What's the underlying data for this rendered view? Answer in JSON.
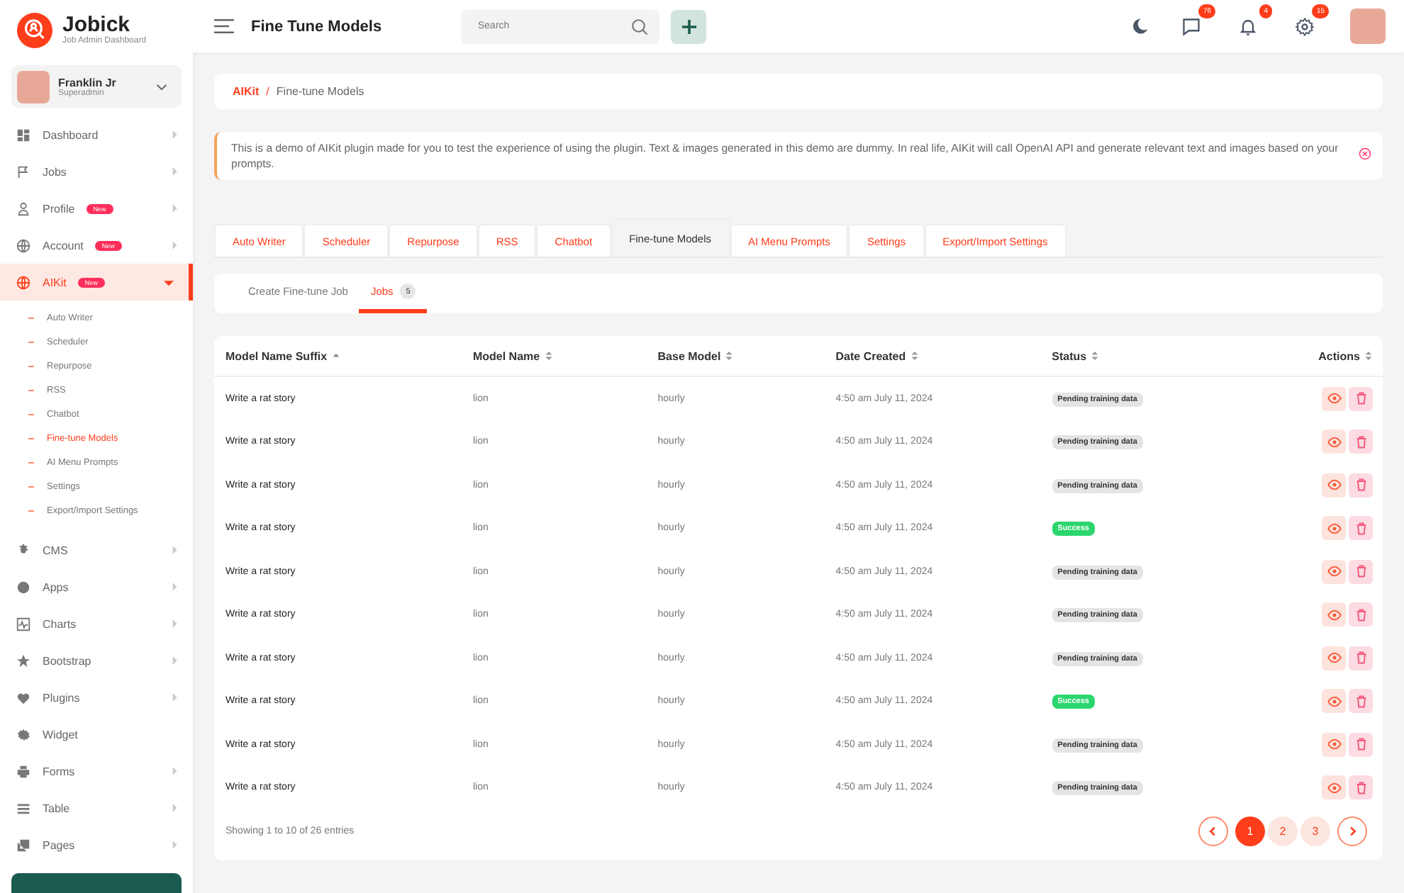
{
  "brand": {
    "name": "Jobick",
    "subtitle": "Job Admin Dashboard"
  },
  "user": {
    "name": "Franklin Jr",
    "role": "Superadmin"
  },
  "sidebar": {
    "items": [
      {
        "label": "Dashboard",
        "has_arrow": true,
        "selected": false
      },
      {
        "label": "Jobs",
        "has_arrow": true,
        "selected": false
      },
      {
        "label": "Profile",
        "badge": "New",
        "has_arrow": true,
        "selected": false
      },
      {
        "label": "Account",
        "badge": "New",
        "has_arrow": true,
        "selected": false
      },
      {
        "label": "AIKit",
        "badge": "New",
        "has_arrow": true,
        "selected": true,
        "expanded": true,
        "children": [
          {
            "label": "Auto Writer",
            "selected": false
          },
          {
            "label": "Scheduler",
            "selected": false
          },
          {
            "label": "Repurpose",
            "selected": false
          },
          {
            "label": "RSS",
            "selected": false
          },
          {
            "label": "Chatbot",
            "selected": false
          },
          {
            "label": "Fine-tune Models",
            "selected": true
          },
          {
            "label": "AI Menu Prompts",
            "selected": false
          },
          {
            "label": "Settings",
            "selected": false
          },
          {
            "label": "Export/Import Settings",
            "selected": false
          }
        ]
      },
      {
        "label": "CMS",
        "has_arrow": true,
        "selected": false
      },
      {
        "label": "Apps",
        "has_arrow": true,
        "selected": false
      },
      {
        "label": "Charts",
        "has_arrow": true,
        "selected": false
      },
      {
        "label": "Bootstrap",
        "has_arrow": true,
        "selected": false
      },
      {
        "label": "Plugins",
        "has_arrow": true,
        "selected": false
      },
      {
        "label": "Widget",
        "has_arrow": false,
        "selected": false
      },
      {
        "label": "Forms",
        "has_arrow": true,
        "selected": false
      },
      {
        "label": "Table",
        "has_arrow": true,
        "selected": false
      },
      {
        "label": "Pages",
        "has_arrow": true,
        "selected": false
      }
    ]
  },
  "header": {
    "title": "Fine Tune Models",
    "search": {
      "placeholder": "Search"
    },
    "counts": {
      "messages": "76",
      "notifications": "4",
      "settings": "15"
    }
  },
  "breadcrumb": {
    "separator": "/",
    "items": [
      "AIKit",
      "Fine-tune Models"
    ]
  },
  "alert": {
    "text": "This is a demo of AIKit plugin made for you to test the experience of using the plugin. Text & images generated in this demo are dummy. In real life, AIKit will call OpenAI API and generate relevant text and images based on your prompts."
  },
  "tabs": [
    {
      "label": "Auto Writer",
      "selected": false
    },
    {
      "label": "Scheduler",
      "selected": false
    },
    {
      "label": "Repurpose",
      "selected": false
    },
    {
      "label": "RSS",
      "selected": false
    },
    {
      "label": "Chatbot",
      "selected": false
    },
    {
      "label": "Fine-tune Models",
      "selected": true
    },
    {
      "label": "AI Menu Prompts",
      "selected": false
    },
    {
      "label": "Settings",
      "selected": false
    },
    {
      "label": "Export/Import Settings",
      "selected": false
    }
  ],
  "subtabs": [
    {
      "label": "Create Fine-tune Job",
      "selected": false
    },
    {
      "label": "Jobs",
      "count": "5",
      "selected": true
    }
  ],
  "table": {
    "columns": [
      {
        "label": "Model Name Suffix",
        "sorted": true
      },
      {
        "label": "Model Name",
        "sorted": false
      },
      {
        "label": "Base Model",
        "sorted": false
      },
      {
        "label": "Date Created",
        "sorted": false
      },
      {
        "label": "Status",
        "sorted": false
      },
      {
        "label": "Actions",
        "sorted": false
      }
    ],
    "rows": [
      {
        "suffix": "Write a rat story",
        "model": "lion",
        "base": "hourly",
        "date": "4:50 am July 11, 2024",
        "status": {
          "label": "Pending training data",
          "kind": "pending"
        }
      },
      {
        "suffix": "Write a rat story",
        "model": "lion",
        "base": "hourly",
        "date": "4:50 am July 11, 2024",
        "status": {
          "label": "Pending training data",
          "kind": "pending"
        }
      },
      {
        "suffix": "Write a rat story",
        "model": "lion",
        "base": "hourly",
        "date": "4:50 am July 11, 2024",
        "status": {
          "label": "Pending training data",
          "kind": "pending"
        }
      },
      {
        "suffix": "Write a rat story",
        "model": "lion",
        "base": "hourly",
        "date": "4:50 am July 11, 2024",
        "status": {
          "label": "Success",
          "kind": "success"
        }
      },
      {
        "suffix": "Write a rat story",
        "model": "lion",
        "base": "hourly",
        "date": "4:50 am July 11, 2024",
        "status": {
          "label": "Pending training data",
          "kind": "pending"
        }
      },
      {
        "suffix": "Write a rat story",
        "model": "lion",
        "base": "hourly",
        "date": "4:50 am July 11, 2024",
        "status": {
          "label": "Pending training data",
          "kind": "pending"
        }
      },
      {
        "suffix": "Write a rat story",
        "model": "lion",
        "base": "hourly",
        "date": "4:50 am July 11, 2024",
        "status": {
          "label": "Pending training data",
          "kind": "pending"
        }
      },
      {
        "suffix": "Write a rat story",
        "model": "lion",
        "base": "hourly",
        "date": "4:50 am July 11, 2024",
        "status": {
          "label": "Success",
          "kind": "success"
        }
      },
      {
        "suffix": "Write a rat story",
        "model": "lion",
        "base": "hourly",
        "date": "4:50 am July 11, 2024",
        "status": {
          "label": "Pending training data",
          "kind": "pending"
        }
      },
      {
        "suffix": "Write a rat story",
        "model": "lion",
        "base": "hourly",
        "date": "4:50 am July 11, 2024",
        "status": {
          "label": "Pending training data",
          "kind": "pending"
        }
      }
    ]
  },
  "footer": {
    "info": "Showing 1 to 10 of 26 entries",
    "pages": [
      {
        "label": "1",
        "selected": true
      },
      {
        "label": "2",
        "selected": false
      },
      {
        "label": "3",
        "selected": false
      }
    ]
  }
}
